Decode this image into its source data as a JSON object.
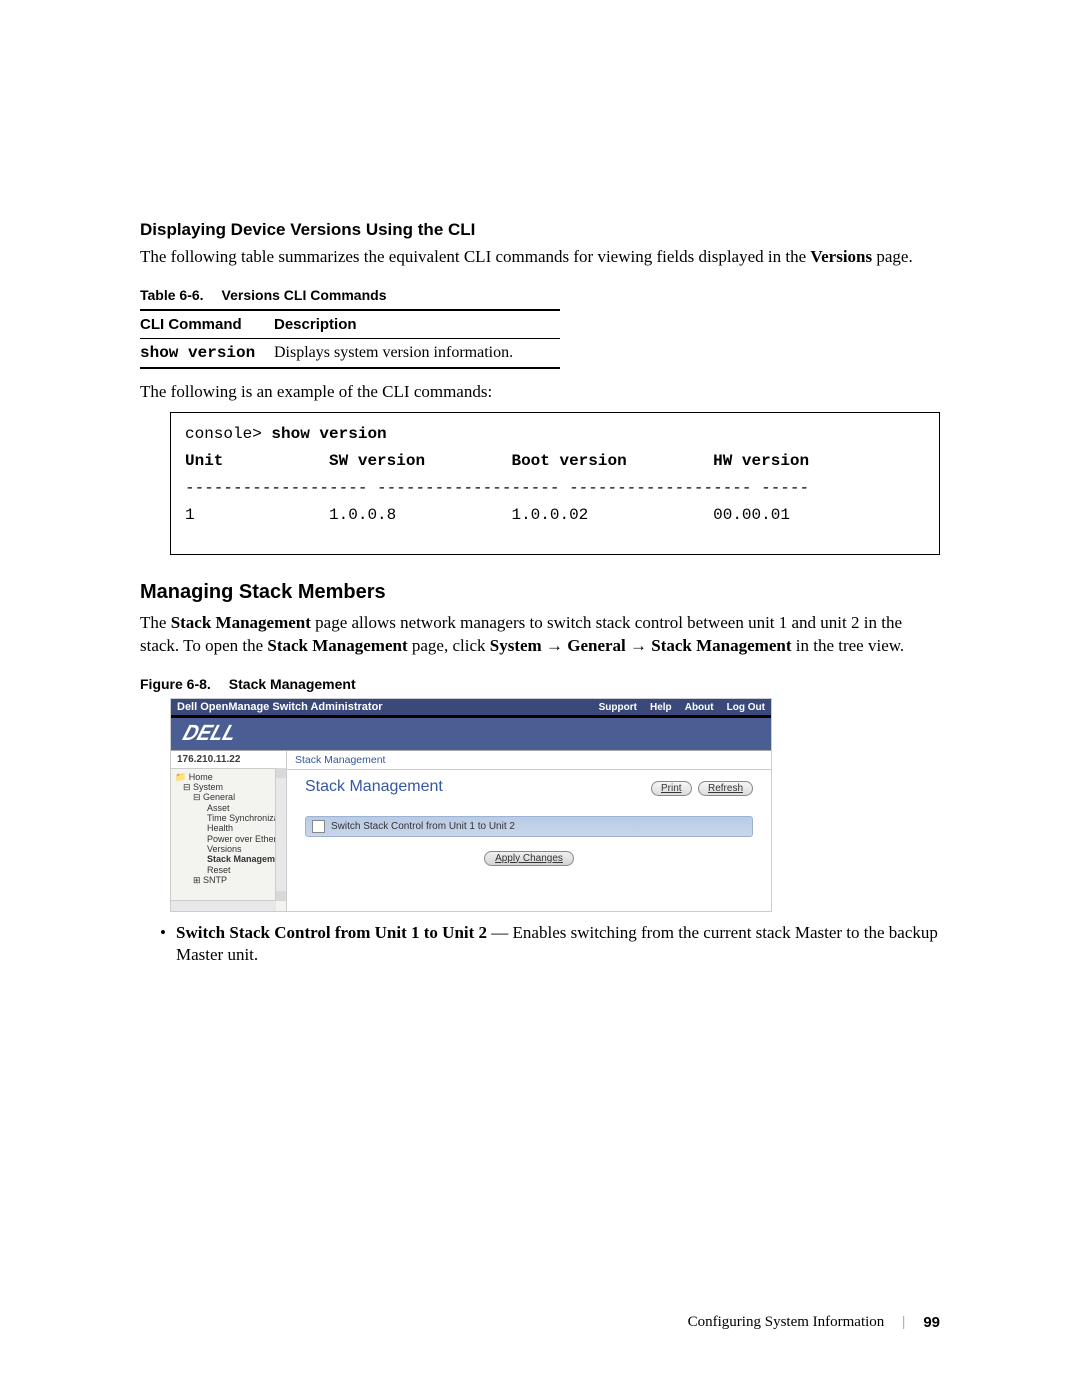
{
  "heading_cli": "Displaying Device Versions Using the CLI",
  "para_cli_1a": "The following table summarizes the equivalent CLI commands for viewing fields displayed in the ",
  "para_cli_1b": "Versions",
  "para_cli_1c": " page.",
  "table_caption_num": "Table 6-6.",
  "table_caption_title": "Versions CLI Commands",
  "table": {
    "h1": "CLI Command",
    "h2": "Description",
    "cmd": "show version",
    "desc": "Displays system version information."
  },
  "para_example": "The following is an example of the CLI commands:",
  "cli": {
    "prompt": "console> ",
    "command": "show version",
    "col1": "Unit",
    "col2": "SW version",
    "col3": "Boot version",
    "col4": "HW version",
    "dashes": "------------------- ------------------- ------------------- -----",
    "v_unit": "1",
    "v_sw": "1.0.0.8",
    "v_boot": "1.0.0.02",
    "v_hw": "00.00.01"
  },
  "heading_stack": "Managing Stack Members",
  "para_stack_a": "The ",
  "para_stack_b": "Stack Management",
  "para_stack_c": " page allows network managers to switch stack control between unit 1 and unit 2 in the stack. To open the ",
  "para_stack_d": "Stack Management",
  "para_stack_e": " page, click ",
  "para_stack_f": "System",
  "para_stack_g": "General",
  "para_stack_h": "Stack Management",
  "para_stack_i": " in the tree view.",
  "arrow": " → ",
  "fig_caption_num": "Figure 6-8.",
  "fig_caption_title": "Stack Management",
  "fig": {
    "title": "Dell OpenManage Switch Administrator",
    "link_support": "Support",
    "link_help": "Help",
    "link_about": "About",
    "link_logout": "Log Out",
    "logo": "DELL",
    "ip": "176.210.11.22",
    "breadcrumb": "Stack Management",
    "panel_title": "Stack Management",
    "btn_print": "Print",
    "btn_refresh": "Refresh",
    "bar_text": "Switch Stack Control from Unit 1 to Unit 2",
    "btn_apply": "Apply Changes",
    "tree": {
      "home": "Home",
      "system": "System",
      "general": "General",
      "asset": "Asset",
      "timesync": "Time Synchroniza",
      "health": "Health",
      "poe": "Power over Ethern",
      "versions": "Versions",
      "stackmgmt": "Stack Managem",
      "reset": "Reset",
      "sntp": "SNTP"
    }
  },
  "bullet_label": "Switch Stack Control from Unit 1 to Unit 2",
  "bullet_sep": " — ",
  "bullet_text": "Enables switching from the current stack Master to the backup Master unit.",
  "footer_text": "Configuring System Information",
  "footer_page": "99"
}
